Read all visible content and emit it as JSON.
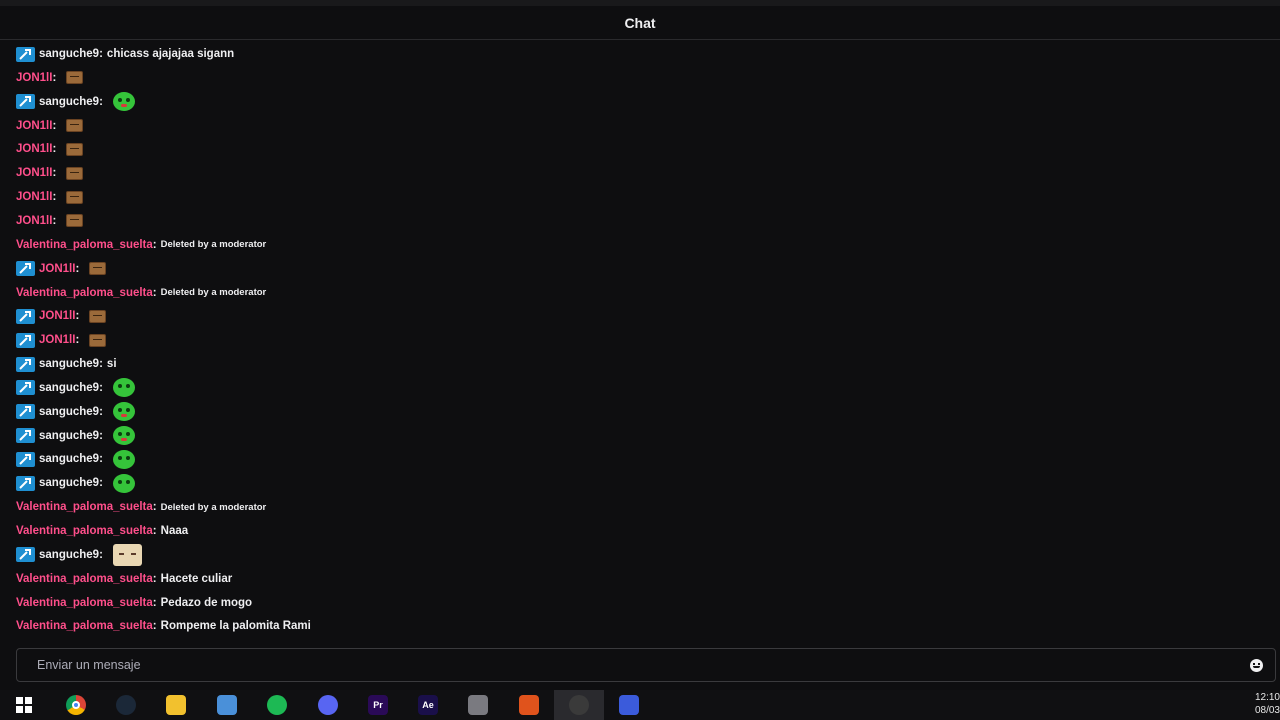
{
  "header": {
    "title": "Chat"
  },
  "colors": {
    "badge": "#1f8fd1",
    "user_pink": "#ff4f8b",
    "text": "#efeff1",
    "background": "#0e0e10"
  },
  "messages": [
    {
      "user": "sanguche9",
      "color": "#efeff1",
      "badge": true,
      "text": "chicass ajajajaa sigann",
      "emote": ""
    },
    {
      "user": "JON1lI",
      "color": "#ff4f8b",
      "badge": false,
      "text": "",
      "emote": "box"
    },
    {
      "user": "sanguche9",
      "color": "#efeff1",
      "badge": true,
      "text": "",
      "emote": "frog-red"
    },
    {
      "user": "JON1lI",
      "color": "#ff4f8b",
      "badge": false,
      "text": "",
      "emote": "box"
    },
    {
      "user": "JON1lI",
      "color": "#ff4f8b",
      "badge": false,
      "text": "",
      "emote": "box"
    },
    {
      "user": "JON1lI",
      "color": "#ff4f8b",
      "badge": false,
      "text": "",
      "emote": "box"
    },
    {
      "user": "JON1lI",
      "color": "#ff4f8b",
      "badge": false,
      "text": "",
      "emote": "box"
    },
    {
      "user": "JON1lI",
      "color": "#ff4f8b",
      "badge": false,
      "text": "",
      "emote": "box"
    },
    {
      "user": "Valentina_paloma_suelta",
      "color": "#ff4f8b",
      "badge": false,
      "deleted": "Deleted by a moderator",
      "emote": ""
    },
    {
      "user": "JON1lI",
      "color": "#ff4f8b",
      "badge": true,
      "text": "",
      "emote": "box"
    },
    {
      "user": "Valentina_paloma_suelta",
      "color": "#ff4f8b",
      "badge": false,
      "deleted": "Deleted by a moderator",
      "emote": ""
    },
    {
      "user": "JON1lI",
      "color": "#ff4f8b",
      "badge": true,
      "text": "",
      "emote": "box"
    },
    {
      "user": "JON1lI",
      "color": "#ff4f8b",
      "badge": true,
      "text": "",
      "emote": "box"
    },
    {
      "user": "sanguche9",
      "color": "#efeff1",
      "badge": true,
      "text": "si",
      "emote": ""
    },
    {
      "user": "sanguche9",
      "color": "#efeff1",
      "badge": true,
      "text": "",
      "emote": "frog"
    },
    {
      "user": "sanguche9",
      "color": "#efeff1",
      "badge": true,
      "text": "",
      "emote": "frog-red"
    },
    {
      "user": "sanguche9",
      "color": "#efeff1",
      "badge": true,
      "text": "",
      "emote": "frog-red"
    },
    {
      "user": "sanguche9",
      "color": "#efeff1",
      "badge": true,
      "text": "",
      "emote": "frog"
    },
    {
      "user": "sanguche9",
      "color": "#efeff1",
      "badge": true,
      "text": "",
      "emote": "frog"
    },
    {
      "user": "Valentina_paloma_suelta",
      "color": "#ff4f8b",
      "badge": false,
      "deleted": "Deleted by a moderator",
      "emote": ""
    },
    {
      "user": "Valentina_paloma_suelta",
      "color": "#ff4f8b",
      "badge": false,
      "text": "Naaa",
      "emote": ""
    },
    {
      "user": "sanguche9",
      "color": "#efeff1",
      "badge": true,
      "text": "",
      "emote": "anime"
    },
    {
      "user": "Valentina_paloma_suelta",
      "color": "#ff4f8b",
      "badge": false,
      "text": "Hacete culiar",
      "emote": ""
    },
    {
      "user": "Valentina_paloma_suelta",
      "color": "#ff4f8b",
      "badge": false,
      "text": "Pedazo de mogo",
      "emote": ""
    },
    {
      "user": "Valentina_paloma_suelta",
      "color": "#ff4f8b",
      "badge": false,
      "text": "Rompeme la palomita Rami",
      "emote": ""
    }
  ],
  "input": {
    "placeholder": "Enviar un mensaje",
    "value": ""
  },
  "taskbar": {
    "icons": [
      {
        "name": "windows-start-icon",
        "label": "",
        "color": "#2b88d8"
      },
      {
        "name": "chrome-icon",
        "label": "",
        "color": "#db4437"
      },
      {
        "name": "steam-icon",
        "label": "",
        "color": "#1b2838"
      },
      {
        "name": "file-explorer-icon",
        "label": "",
        "color": "#f2c12e"
      },
      {
        "name": "photos-icon",
        "label": "",
        "color": "#4a90d9"
      },
      {
        "name": "spotify-icon",
        "label": "",
        "color": "#1db954"
      },
      {
        "name": "discord-icon",
        "label": "",
        "color": "#5865f2"
      },
      {
        "name": "premiere-icon",
        "label": "Pr",
        "color": "#2a0a57"
      },
      {
        "name": "after-effects-icon",
        "label": "Ae",
        "color": "#1a0f4a"
      },
      {
        "name": "settings-icon",
        "label": "",
        "color": "#7a7a80"
      },
      {
        "name": "microphone-icon",
        "label": "",
        "color": "#e0531c"
      },
      {
        "name": "obs-icon",
        "label": "",
        "color": "#3a3a3a"
      },
      {
        "name": "app-icon",
        "label": "",
        "color": "#3b5bdb"
      }
    ],
    "time": "12:10",
    "date": "08/03"
  }
}
